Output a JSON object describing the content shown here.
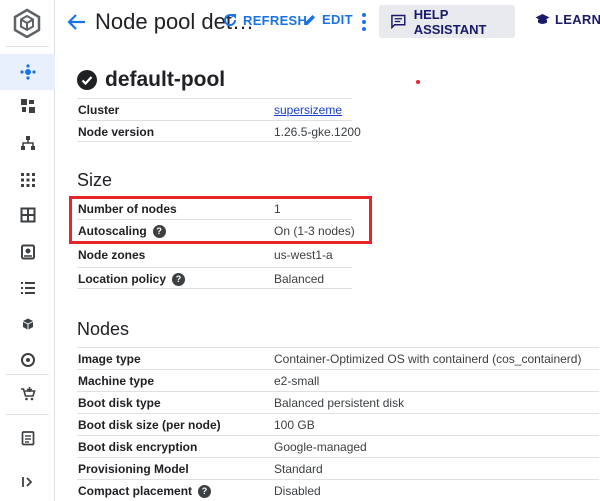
{
  "header": {
    "title": "Node pool det…",
    "refresh_label": "REFRESH",
    "edit_label": "EDIT",
    "help_label": "HELP ASSISTANT",
    "learn_label": "LEARN"
  },
  "rail": {
    "icons": [
      "kubernetes-logo-icon",
      "clusters-icon",
      "workloads-icon",
      "services-icon",
      "apps-icon",
      "secrets-icon",
      "storage-icon",
      "object-browser-icon",
      "migrate-icon",
      "backup-icon",
      "marketplace-icon",
      "release-notes-icon",
      "collapse-icon"
    ]
  },
  "pool": {
    "name": "default-pool",
    "cluster_label": "Cluster",
    "cluster_value": "supersizeme",
    "version_label": "Node version",
    "version_value": "1.26.5-gke.1200"
  },
  "size": {
    "title": "Size",
    "rows": [
      {
        "label": "Number of nodes",
        "value": "1"
      },
      {
        "label": "Autoscaling",
        "value": "On (1-3 nodes)"
      },
      {
        "label": "Node zones",
        "value": "us-west1-a"
      },
      {
        "label": "Location policy",
        "value": "Balanced"
      }
    ]
  },
  "nodes": {
    "title": "Nodes",
    "rows": [
      {
        "label": "Image type",
        "value": "Container-Optimized OS with containerd (cos_containerd)"
      },
      {
        "label": "Machine type",
        "value": "e2-small"
      },
      {
        "label": "Boot disk type",
        "value": "Balanced persistent disk"
      },
      {
        "label": "Boot disk size (per node)",
        "value": "100 GB"
      },
      {
        "label": "Boot disk encryption",
        "value": "Google-managed"
      },
      {
        "label": "Provisioning Model",
        "value": "Standard"
      },
      {
        "label": "Compact placement",
        "value": "Disabled"
      }
    ]
  },
  "help_glyph": "?"
}
